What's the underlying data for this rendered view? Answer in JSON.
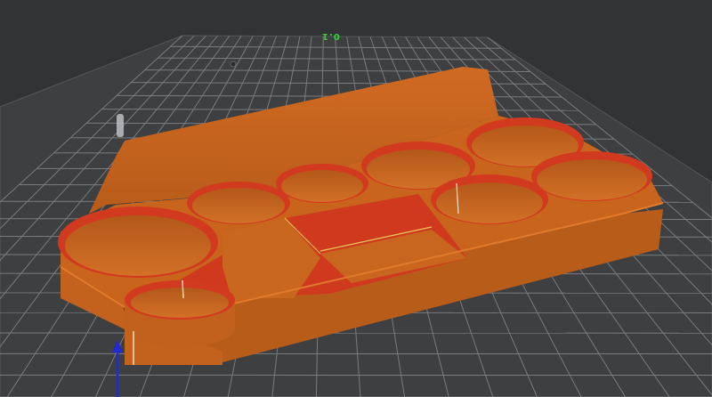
{
  "viewport": {
    "background_color": "#323335",
    "plate_color": "#3e3f41",
    "grid_color": "#7a7b7e",
    "plate_label": "0.1",
    "plate_label_color": "#2fd32f"
  },
  "model": {
    "body_color": "#c8641c",
    "shade_color": "#a44e12",
    "infill_color": "#d0311e",
    "seam_color": "#e8c85a"
  },
  "axis": {
    "z_color": "#1f2bd6",
    "icon": "z-axis-arrow-icon"
  },
  "icons": {
    "origin_marker": "origin-marker-icon",
    "plate_notch": "plate-notch-icon"
  }
}
